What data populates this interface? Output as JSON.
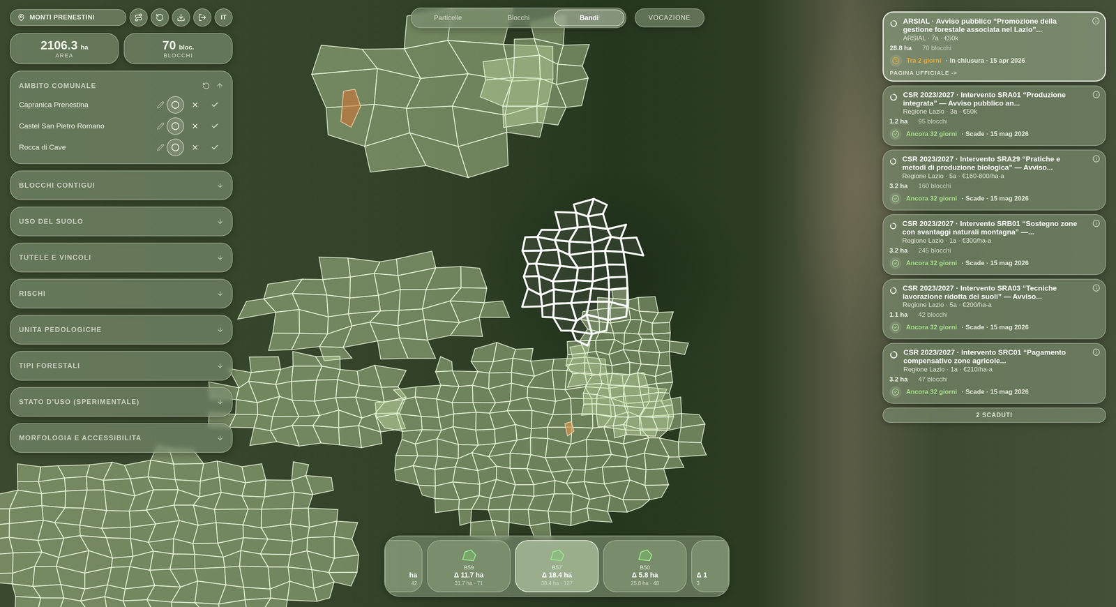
{
  "location": {
    "name": "MONTI PRENESTINI"
  },
  "toolbar": {
    "language": "IT"
  },
  "stats": [
    {
      "value": "2106.3",
      "unit": "ha",
      "label": "AREA"
    },
    {
      "value": "70",
      "unit": "bloc.",
      "label": "BLOCCHI"
    }
  ],
  "municipality_panel": {
    "title": "AMBITO COMUNALE",
    "rows": [
      {
        "name": "Capranica Prenestina",
        "options": [
          {
            "kind": "neutral",
            "selected": true
          },
          {
            "kind": "exclude",
            "selected": false
          },
          {
            "kind": "include",
            "selected": false
          }
        ]
      },
      {
        "name": "Castel San Pietro Romano",
        "options": [
          {
            "kind": "neutral",
            "selected": true
          },
          {
            "kind": "exclude",
            "selected": false
          },
          {
            "kind": "include",
            "selected": false
          }
        ]
      },
      {
        "name": "Rocca di Cave",
        "options": [
          {
            "kind": "neutral",
            "selected": true
          },
          {
            "kind": "exclude",
            "selected": false
          },
          {
            "kind": "include",
            "selected": false
          }
        ]
      }
    ]
  },
  "sections": [
    {
      "title": "BLOCCHI CONTIGUI",
      "expanded": false
    },
    {
      "title": "USO DEL SUOLO",
      "expanded": false
    },
    {
      "title": "TUTELE E VINCOLI",
      "expanded": false
    },
    {
      "title": "RISCHI",
      "expanded": false
    },
    {
      "title": "UNITA PEDOLOGICHE",
      "expanded": false
    },
    {
      "title": "TIPI FORESTALI",
      "expanded": false
    },
    {
      "title": "STATO D'USO (SPERIMENTALE)",
      "expanded": false
    },
    {
      "title": "MORFOLOGIA E ACCESSIBILITA",
      "expanded": false
    }
  ],
  "tabs": [
    {
      "label": "Particelle",
      "selected": false
    },
    {
      "label": "Blocchi",
      "selected": false
    },
    {
      "label": "Bandi",
      "selected": true
    }
  ],
  "vocation_button": {
    "label": "VOCAZIONE"
  },
  "calls": [
    {
      "title": "ARSIAL · Avviso pubblico “Promozione della gestione forestale associata nel Lazio”...",
      "meta": "ARSIAL · 7a · €50k",
      "area": "28.8 ha",
      "blocks": "70 blocchi",
      "status": "closing",
      "deadline": "Tra 2 giorni",
      "detail": "· In chiusura · 15 apr 2026",
      "color": "#e8a93a",
      "highlighted": true,
      "link": "PAGINA UFFICIALE ->"
    },
    {
      "title": "CSR 2023/2027 · Intervento SRA01 “Produzione integrata” — Avviso pubblico an...",
      "meta": "Regione Lazio · 3a · €50k",
      "area": "1.2 ha",
      "blocks": "95 blocchi",
      "status": "open",
      "deadline": "Ancora 32 giorni",
      "detail": "· Scade · 15 mag 2026",
      "color": "#a8e08e",
      "highlighted": false
    },
    {
      "title": "CSR 2023/2027 · Intervento SRA29 “Pratiche e metodi di produzione biologica” — Avviso...",
      "meta": "Regione Lazio · 5a · €160-800/ha-a",
      "area": "3.2 ha",
      "blocks": "160 blocchi",
      "status": "open",
      "deadline": "Ancora 32 giorni",
      "detail": "· Scade · 15 mag 2026",
      "color": "#a8e08e",
      "highlighted": false
    },
    {
      "title": "CSR 2023/2027 · Intervento SRB01 “Sostegno zone con svantaggi naturali montagna” —...",
      "meta": "Regione Lazio · 1a · €300/ha-a",
      "area": "3.2 ha",
      "blocks": "245 blocchi",
      "status": "open",
      "deadline": "Ancora 32 giorni",
      "detail": "· Scade · 15 mag 2026",
      "color": "#a8e08e",
      "highlighted": false
    },
    {
      "title": "CSR 2023/2027 · Intervento SRA03 “Tecniche lavorazione ridotta dei suoli” — Avviso...",
      "meta": "Regione Lazio · 5a · €200/ha-a",
      "area": "1.1 ha",
      "blocks": "42 blocchi",
      "status": "open",
      "deadline": "Ancora 32 giorni",
      "detail": "· Scade · 15 mag 2026",
      "color": "#a8e08e",
      "highlighted": false
    },
    {
      "title": "CSR 2023/2027 · Intervento SRC01 “Pagamento compensativo zone agricole...",
      "meta": "Regione Lazio · 1a · €210/ha-a",
      "area": "3.2 ha",
      "blocks": "47 blocchi",
      "status": "open",
      "deadline": "Ancora 32 giorni",
      "detail": "· Scade · 15 mag 2026",
      "color": "#a8e08e",
      "highlighted": false
    }
  ],
  "expired_button": {
    "label": "2 SCADUTI"
  },
  "blocks_carousel": [
    {
      "kind": "start",
      "code": "",
      "delta": "ha",
      "summary": "42",
      "selected": false
    },
    {
      "kind": "full",
      "code": "B59",
      "delta": "Δ 11.7 ha",
      "summary": "31.7 ha · 71",
      "selected": false
    },
    {
      "kind": "full",
      "code": "B57",
      "delta": "Δ 18.4 ha",
      "summary": "38.4 ha · 127",
      "selected": true
    },
    {
      "kind": "full",
      "code": "B50",
      "delta": "Δ 5.8 ha",
      "summary": "25.8 ha · 48",
      "selected": false
    },
    {
      "kind": "end",
      "code": "",
      "delta": "Δ 1",
      "summary": "3",
      "selected": false
    }
  ]
}
